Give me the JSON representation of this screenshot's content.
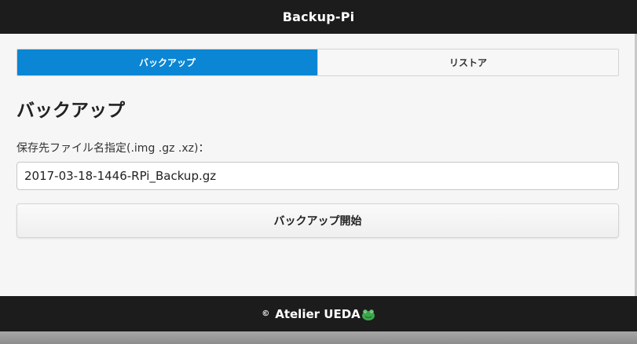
{
  "header": {
    "title": "Backup-Pi"
  },
  "tabs": [
    {
      "label": "バックアップ",
      "active": true
    },
    {
      "label": "リストア",
      "active": false
    }
  ],
  "main": {
    "title": "バックアップ",
    "field_label": "保存先ファイル名指定(.img .gz .xz)：",
    "filename_value": "2017-03-18-1446-RPi_Backup.gz",
    "start_button_label": "バックアップ開始"
  },
  "footer": {
    "copyright_symbol": "©",
    "text": "Atelier UEDA",
    "icon": "frog-icon"
  },
  "colors": {
    "header_bg": "#1c1c1c",
    "active_tab": "#0b86d4",
    "page_bg": "#f6f6f6"
  }
}
